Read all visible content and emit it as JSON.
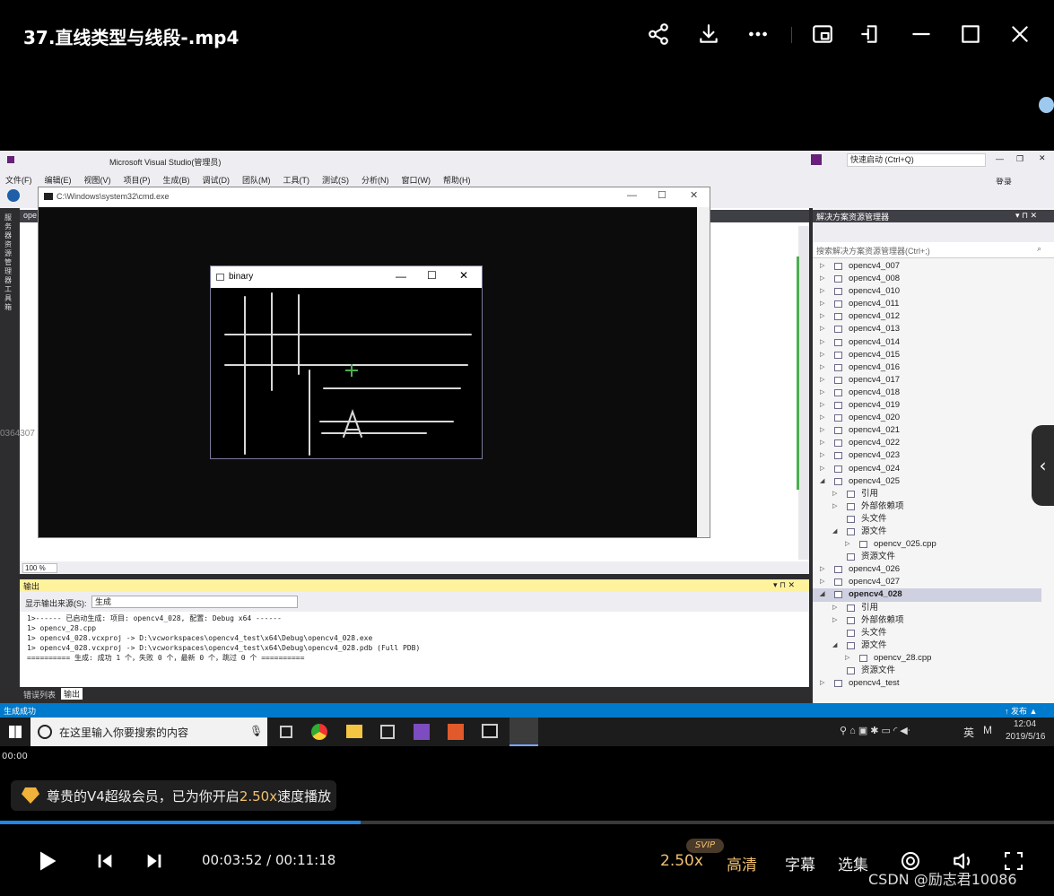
{
  "player": {
    "title": "37.直线类型与线段-.mp4",
    "elapsed_small": "00:00",
    "notice_prefix": "尊贵的V4超级会员，已为你开启",
    "notice_speed": "2.50x",
    "notice_suffix": "速度播放",
    "progress": 0.342,
    "time_display": "00:03:52 / 00:11:18",
    "speed_label": "2.50x",
    "svip_badge": "SVIP",
    "quality_label": "高清",
    "subtitle_label": "字幕",
    "episodes_label": "选集",
    "watermark": "CSDN @励志君10086",
    "accent_color": "#1e88e5",
    "speed_color": "#f0c070"
  },
  "vs": {
    "window_title": "Microsoft Visual Studio(管理员)",
    "menu": [
      "文件(F)",
      "编辑(E)",
      "视图(V)",
      "项目(P)",
      "生成(B)",
      "调试(D)",
      "团队(M)",
      "工具(T)",
      "测试(S)",
      "分析(N)",
      "窗口(W)",
      "帮助(H)"
    ],
    "quick_launch": "快速启动 (Ctrl+Q)",
    "login": "登录",
    "left_strip": "服务器资源管理器 工具箱",
    "editor_tab": "ope",
    "side_number": "0364307",
    "zoom": "100 %",
    "cmd_title": "C:\\Windows\\system32\\cmd.exe",
    "binary_title": "binary",
    "output": {
      "header": "输出",
      "source_label": "显示输出来源(S):",
      "source_value": "生成",
      "lines": [
        "1>------ 已启动生成: 项目: opencv4_028, 配置: Debug x64 ------",
        "1>  opencv_28.cpp",
        "1>  opencv4_028.vcxproj -> D:\\vcworkspaces\\opencv4_test\\x64\\Debug\\opencv4_028.exe",
        "1>  opencv4_028.vcxproj -> D:\\vcworkspaces\\opencv4_test\\x64\\Debug\\opencv4_028.pdb (Full PDB)",
        "========== 生成: 成功 1 个，失败 0 个，最新 0 个，跳过 0 个 =========="
      ],
      "tabs": [
        "错误列表",
        "输出"
      ]
    },
    "solution": {
      "header": "解决方案资源管理器",
      "search_placeholder": "搜索解决方案资源管理器(Ctrl+;)",
      "items": [
        {
          "label": "opencv4_007",
          "level": 0,
          "tri": "▷"
        },
        {
          "label": "opencv4_008",
          "level": 0,
          "tri": "▷"
        },
        {
          "label": "opencv4_010",
          "level": 0,
          "tri": "▷"
        },
        {
          "label": "opencv4_011",
          "level": 0,
          "tri": "▷"
        },
        {
          "label": "opencv4_012",
          "level": 0,
          "tri": "▷"
        },
        {
          "label": "opencv4_013",
          "level": 0,
          "tri": "▷"
        },
        {
          "label": "opencv4_014",
          "level": 0,
          "tri": "▷"
        },
        {
          "label": "opencv4_015",
          "level": 0,
          "tri": "▷"
        },
        {
          "label": "opencv4_016",
          "level": 0,
          "tri": "▷"
        },
        {
          "label": "opencv4_017",
          "level": 0,
          "tri": "▷"
        },
        {
          "label": "opencv4_018",
          "level": 0,
          "tri": "▷"
        },
        {
          "label": "opencv4_019",
          "level": 0,
          "tri": "▷"
        },
        {
          "label": "opencv4_020",
          "level": 0,
          "tri": "▷"
        },
        {
          "label": "opencv4_021",
          "level": 0,
          "tri": "▷"
        },
        {
          "label": "opencv4_022",
          "level": 0,
          "tri": "▷"
        },
        {
          "label": "opencv4_023",
          "level": 0,
          "tri": "▷"
        },
        {
          "label": "opencv4_024",
          "level": 0,
          "tri": "▷"
        },
        {
          "label": "opencv4_025",
          "level": 0,
          "tri": "◢"
        },
        {
          "label": "引用",
          "level": 1,
          "tri": "▷"
        },
        {
          "label": "外部依赖项",
          "level": 1,
          "tri": "▷"
        },
        {
          "label": "头文件",
          "level": 1,
          "tri": ""
        },
        {
          "label": "源文件",
          "level": 1,
          "tri": "◢"
        },
        {
          "label": "opencv_025.cpp",
          "level": 2,
          "tri": "▷"
        },
        {
          "label": "资源文件",
          "level": 1,
          "tri": ""
        },
        {
          "label": "opencv4_026",
          "level": 0,
          "tri": "▷"
        },
        {
          "label": "opencv4_027",
          "level": 0,
          "tri": "▷"
        },
        {
          "label": "opencv4_028",
          "level": 0,
          "tri": "◢",
          "selected": true
        },
        {
          "label": "引用",
          "level": 1,
          "tri": "▷"
        },
        {
          "label": "外部依赖项",
          "level": 1,
          "tri": "▷"
        },
        {
          "label": "头文件",
          "level": 1,
          "tri": ""
        },
        {
          "label": "源文件",
          "level": 1,
          "tri": "◢"
        },
        {
          "label": "opencv_28.cpp",
          "level": 2,
          "tri": "▷"
        },
        {
          "label": "资源文件",
          "level": 1,
          "tri": ""
        },
        {
          "label": "opencv4_test",
          "level": 0,
          "tri": "▷"
        }
      ]
    },
    "status_left": "生成成功",
    "status_right": "↑ 发布 ▲"
  },
  "taskbar": {
    "search_placeholder": "在这里输入你要搜索的内容",
    "ime": "英",
    "time": "12:04",
    "date": "2019/5/16"
  }
}
